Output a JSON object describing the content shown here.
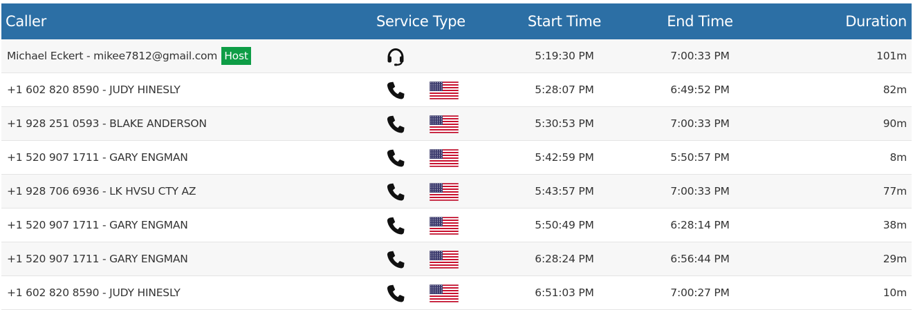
{
  "columns": {
    "caller": "Caller",
    "service_type": "Service Type",
    "start_time": "Start Time",
    "end_time": "End Time",
    "duration": "Duration"
  },
  "colors": {
    "header_bg": "#2c6fa5",
    "host_badge_bg": "#0e9d46"
  },
  "rows": [
    {
      "caller": "Michael Eckert - mikee7812@gmail.com",
      "badge": "Host",
      "service_icon": "headset-icon",
      "flag": "",
      "start": "5:19:30 PM",
      "end": "7:00:33 PM",
      "duration": "101m"
    },
    {
      "caller": "+1 602 820 8590 - JUDY HINESLY",
      "badge": "",
      "service_icon": "phone-icon",
      "flag": "us-flag-icon",
      "start": "5:28:07 PM",
      "end": "6:49:52 PM",
      "duration": "82m"
    },
    {
      "caller": "+1 928 251 0593 - BLAKE ANDERSON",
      "badge": "",
      "service_icon": "phone-icon",
      "flag": "us-flag-icon",
      "start": "5:30:53 PM",
      "end": "7:00:33 PM",
      "duration": "90m"
    },
    {
      "caller": "+1 520 907 1711 - GARY ENGMAN",
      "badge": "",
      "service_icon": "phone-icon",
      "flag": "us-flag-icon",
      "start": "5:42:59 PM",
      "end": "5:50:57 PM",
      "duration": "8m"
    },
    {
      "caller": "+1 928 706 6936 - LK HVSU CTY AZ",
      "badge": "",
      "service_icon": "phone-icon",
      "flag": "us-flag-icon",
      "start": "5:43:57 PM",
      "end": "7:00:33 PM",
      "duration": "77m"
    },
    {
      "caller": "+1 520 907 1711 - GARY ENGMAN",
      "badge": "",
      "service_icon": "phone-icon",
      "flag": "us-flag-icon",
      "start": "5:50:49 PM",
      "end": "6:28:14 PM",
      "duration": "38m"
    },
    {
      "caller": "+1 520 907 1711 - GARY ENGMAN",
      "badge": "",
      "service_icon": "phone-icon",
      "flag": "us-flag-icon",
      "start": "6:28:24 PM",
      "end": "6:56:44 PM",
      "duration": "29m"
    },
    {
      "caller": "+1 602 820 8590 - JUDY HINESLY",
      "badge": "",
      "service_icon": "phone-icon",
      "flag": "us-flag-icon",
      "start": "6:51:03 PM",
      "end": "7:00:27 PM",
      "duration": "10m"
    }
  ]
}
